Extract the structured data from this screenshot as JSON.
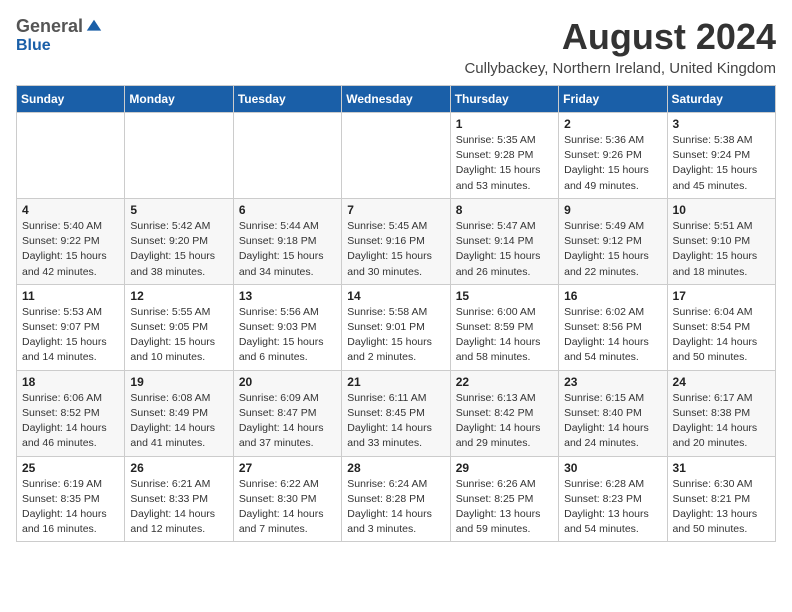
{
  "logo": {
    "general": "General",
    "blue": "Blue"
  },
  "title": "August 2024",
  "subtitle": "Cullybackey, Northern Ireland, United Kingdom",
  "weekdays": [
    "Sunday",
    "Monday",
    "Tuesday",
    "Wednesday",
    "Thursday",
    "Friday",
    "Saturday"
  ],
  "weeks": [
    [
      {
        "day": "",
        "info": ""
      },
      {
        "day": "",
        "info": ""
      },
      {
        "day": "",
        "info": ""
      },
      {
        "day": "",
        "info": ""
      },
      {
        "day": "1",
        "info": "Sunrise: 5:35 AM\nSunset: 9:28 PM\nDaylight: 15 hours\nand 53 minutes."
      },
      {
        "day": "2",
        "info": "Sunrise: 5:36 AM\nSunset: 9:26 PM\nDaylight: 15 hours\nand 49 minutes."
      },
      {
        "day": "3",
        "info": "Sunrise: 5:38 AM\nSunset: 9:24 PM\nDaylight: 15 hours\nand 45 minutes."
      }
    ],
    [
      {
        "day": "4",
        "info": "Sunrise: 5:40 AM\nSunset: 9:22 PM\nDaylight: 15 hours\nand 42 minutes."
      },
      {
        "day": "5",
        "info": "Sunrise: 5:42 AM\nSunset: 9:20 PM\nDaylight: 15 hours\nand 38 minutes."
      },
      {
        "day": "6",
        "info": "Sunrise: 5:44 AM\nSunset: 9:18 PM\nDaylight: 15 hours\nand 34 minutes."
      },
      {
        "day": "7",
        "info": "Sunrise: 5:45 AM\nSunset: 9:16 PM\nDaylight: 15 hours\nand 30 minutes."
      },
      {
        "day": "8",
        "info": "Sunrise: 5:47 AM\nSunset: 9:14 PM\nDaylight: 15 hours\nand 26 minutes."
      },
      {
        "day": "9",
        "info": "Sunrise: 5:49 AM\nSunset: 9:12 PM\nDaylight: 15 hours\nand 22 minutes."
      },
      {
        "day": "10",
        "info": "Sunrise: 5:51 AM\nSunset: 9:10 PM\nDaylight: 15 hours\nand 18 minutes."
      }
    ],
    [
      {
        "day": "11",
        "info": "Sunrise: 5:53 AM\nSunset: 9:07 PM\nDaylight: 15 hours\nand 14 minutes."
      },
      {
        "day": "12",
        "info": "Sunrise: 5:55 AM\nSunset: 9:05 PM\nDaylight: 15 hours\nand 10 minutes."
      },
      {
        "day": "13",
        "info": "Sunrise: 5:56 AM\nSunset: 9:03 PM\nDaylight: 15 hours\nand 6 minutes."
      },
      {
        "day": "14",
        "info": "Sunrise: 5:58 AM\nSunset: 9:01 PM\nDaylight: 15 hours\nand 2 minutes."
      },
      {
        "day": "15",
        "info": "Sunrise: 6:00 AM\nSunset: 8:59 PM\nDaylight: 14 hours\nand 58 minutes."
      },
      {
        "day": "16",
        "info": "Sunrise: 6:02 AM\nSunset: 8:56 PM\nDaylight: 14 hours\nand 54 minutes."
      },
      {
        "day": "17",
        "info": "Sunrise: 6:04 AM\nSunset: 8:54 PM\nDaylight: 14 hours\nand 50 minutes."
      }
    ],
    [
      {
        "day": "18",
        "info": "Sunrise: 6:06 AM\nSunset: 8:52 PM\nDaylight: 14 hours\nand 46 minutes."
      },
      {
        "day": "19",
        "info": "Sunrise: 6:08 AM\nSunset: 8:49 PM\nDaylight: 14 hours\nand 41 minutes."
      },
      {
        "day": "20",
        "info": "Sunrise: 6:09 AM\nSunset: 8:47 PM\nDaylight: 14 hours\nand 37 minutes."
      },
      {
        "day": "21",
        "info": "Sunrise: 6:11 AM\nSunset: 8:45 PM\nDaylight: 14 hours\nand 33 minutes."
      },
      {
        "day": "22",
        "info": "Sunrise: 6:13 AM\nSunset: 8:42 PM\nDaylight: 14 hours\nand 29 minutes."
      },
      {
        "day": "23",
        "info": "Sunrise: 6:15 AM\nSunset: 8:40 PM\nDaylight: 14 hours\nand 24 minutes."
      },
      {
        "day": "24",
        "info": "Sunrise: 6:17 AM\nSunset: 8:38 PM\nDaylight: 14 hours\nand 20 minutes."
      }
    ],
    [
      {
        "day": "25",
        "info": "Sunrise: 6:19 AM\nSunset: 8:35 PM\nDaylight: 14 hours\nand 16 minutes."
      },
      {
        "day": "26",
        "info": "Sunrise: 6:21 AM\nSunset: 8:33 PM\nDaylight: 14 hours\nand 12 minutes."
      },
      {
        "day": "27",
        "info": "Sunrise: 6:22 AM\nSunset: 8:30 PM\nDaylight: 14 hours\nand 7 minutes."
      },
      {
        "day": "28",
        "info": "Sunrise: 6:24 AM\nSunset: 8:28 PM\nDaylight: 14 hours\nand 3 minutes."
      },
      {
        "day": "29",
        "info": "Sunrise: 6:26 AM\nSunset: 8:25 PM\nDaylight: 13 hours\nand 59 minutes."
      },
      {
        "day": "30",
        "info": "Sunrise: 6:28 AM\nSunset: 8:23 PM\nDaylight: 13 hours\nand 54 minutes."
      },
      {
        "day": "31",
        "info": "Sunrise: 6:30 AM\nSunset: 8:21 PM\nDaylight: 13 hours\nand 50 minutes."
      }
    ]
  ]
}
